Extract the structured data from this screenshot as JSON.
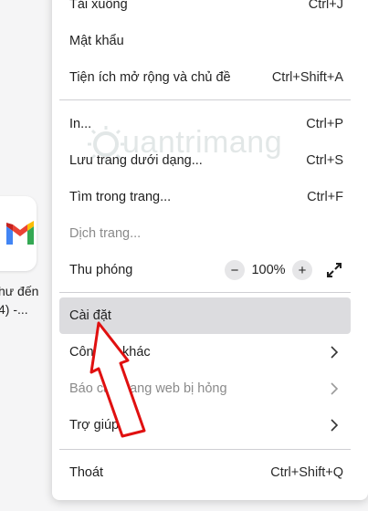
{
  "background": {
    "tile_caption_line1": "hư đến",
    "tile_caption_line2": "4) -..."
  },
  "menu": {
    "downloads": {
      "label": "Tải xuống",
      "shortcut": "Ctrl+J"
    },
    "passwords": {
      "label": "Mật khẩu"
    },
    "extensions": {
      "label": "Tiện ích mở rộng và chủ đề",
      "shortcut": "Ctrl+Shift+A"
    },
    "print": {
      "label": "In...",
      "shortcut": "Ctrl+P"
    },
    "save_page": {
      "label": "Lưu trang dưới dạng...",
      "shortcut": "Ctrl+S"
    },
    "find": {
      "label": "Tìm trong trang...",
      "shortcut": "Ctrl+F"
    },
    "translate": {
      "label": "Dịch trang..."
    },
    "zoom": {
      "label": "Thu phóng",
      "minus": "−",
      "value": "100%",
      "plus": "+"
    },
    "settings": {
      "label": "Cài đặt"
    },
    "more_tools": {
      "label": "Công cụ khác"
    },
    "report_broken": {
      "label": "Báo cáo trang web bị hỏng"
    },
    "help": {
      "label": "Trợ giúp"
    },
    "quit": {
      "label": "Thoát",
      "shortcut": "Ctrl+Shift+Q"
    }
  },
  "watermark": {
    "text": "uantrimang"
  },
  "colors": {
    "highlight": "#dcdcdf",
    "arrow": "#e01010",
    "disabled_text": "#8a8a8a"
  }
}
